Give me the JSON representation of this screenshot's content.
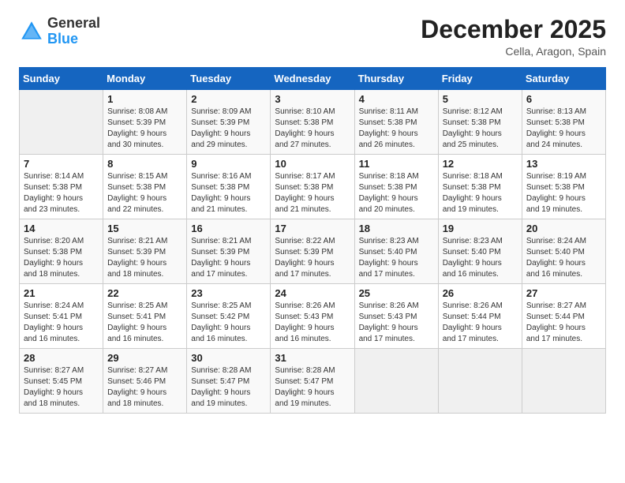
{
  "header": {
    "logo_general": "General",
    "logo_blue": "Blue",
    "month_title": "December 2025",
    "location": "Cella, Aragon, Spain"
  },
  "weekdays": [
    "Sunday",
    "Monday",
    "Tuesday",
    "Wednesday",
    "Thursday",
    "Friday",
    "Saturday"
  ],
  "weeks": [
    [
      {
        "day": "",
        "info": ""
      },
      {
        "day": "1",
        "info": "Sunrise: 8:08 AM\nSunset: 5:39 PM\nDaylight: 9 hours\nand 30 minutes."
      },
      {
        "day": "2",
        "info": "Sunrise: 8:09 AM\nSunset: 5:39 PM\nDaylight: 9 hours\nand 29 minutes."
      },
      {
        "day": "3",
        "info": "Sunrise: 8:10 AM\nSunset: 5:38 PM\nDaylight: 9 hours\nand 27 minutes."
      },
      {
        "day": "4",
        "info": "Sunrise: 8:11 AM\nSunset: 5:38 PM\nDaylight: 9 hours\nand 26 minutes."
      },
      {
        "day": "5",
        "info": "Sunrise: 8:12 AM\nSunset: 5:38 PM\nDaylight: 9 hours\nand 25 minutes."
      },
      {
        "day": "6",
        "info": "Sunrise: 8:13 AM\nSunset: 5:38 PM\nDaylight: 9 hours\nand 24 minutes."
      }
    ],
    [
      {
        "day": "7",
        "info": "Sunrise: 8:14 AM\nSunset: 5:38 PM\nDaylight: 9 hours\nand 23 minutes."
      },
      {
        "day": "8",
        "info": "Sunrise: 8:15 AM\nSunset: 5:38 PM\nDaylight: 9 hours\nand 22 minutes."
      },
      {
        "day": "9",
        "info": "Sunrise: 8:16 AM\nSunset: 5:38 PM\nDaylight: 9 hours\nand 21 minutes."
      },
      {
        "day": "10",
        "info": "Sunrise: 8:17 AM\nSunset: 5:38 PM\nDaylight: 9 hours\nand 21 minutes."
      },
      {
        "day": "11",
        "info": "Sunrise: 8:18 AM\nSunset: 5:38 PM\nDaylight: 9 hours\nand 20 minutes."
      },
      {
        "day": "12",
        "info": "Sunrise: 8:18 AM\nSunset: 5:38 PM\nDaylight: 9 hours\nand 19 minutes."
      },
      {
        "day": "13",
        "info": "Sunrise: 8:19 AM\nSunset: 5:38 PM\nDaylight: 9 hours\nand 19 minutes."
      }
    ],
    [
      {
        "day": "14",
        "info": "Sunrise: 8:20 AM\nSunset: 5:38 PM\nDaylight: 9 hours\nand 18 minutes."
      },
      {
        "day": "15",
        "info": "Sunrise: 8:21 AM\nSunset: 5:39 PM\nDaylight: 9 hours\nand 18 minutes."
      },
      {
        "day": "16",
        "info": "Sunrise: 8:21 AM\nSunset: 5:39 PM\nDaylight: 9 hours\nand 17 minutes."
      },
      {
        "day": "17",
        "info": "Sunrise: 8:22 AM\nSunset: 5:39 PM\nDaylight: 9 hours\nand 17 minutes."
      },
      {
        "day": "18",
        "info": "Sunrise: 8:23 AM\nSunset: 5:40 PM\nDaylight: 9 hours\nand 17 minutes."
      },
      {
        "day": "19",
        "info": "Sunrise: 8:23 AM\nSunset: 5:40 PM\nDaylight: 9 hours\nand 16 minutes."
      },
      {
        "day": "20",
        "info": "Sunrise: 8:24 AM\nSunset: 5:40 PM\nDaylight: 9 hours\nand 16 minutes."
      }
    ],
    [
      {
        "day": "21",
        "info": "Sunrise: 8:24 AM\nSunset: 5:41 PM\nDaylight: 9 hours\nand 16 minutes."
      },
      {
        "day": "22",
        "info": "Sunrise: 8:25 AM\nSunset: 5:41 PM\nDaylight: 9 hours\nand 16 minutes."
      },
      {
        "day": "23",
        "info": "Sunrise: 8:25 AM\nSunset: 5:42 PM\nDaylight: 9 hours\nand 16 minutes."
      },
      {
        "day": "24",
        "info": "Sunrise: 8:26 AM\nSunset: 5:43 PM\nDaylight: 9 hours\nand 16 minutes."
      },
      {
        "day": "25",
        "info": "Sunrise: 8:26 AM\nSunset: 5:43 PM\nDaylight: 9 hours\nand 17 minutes."
      },
      {
        "day": "26",
        "info": "Sunrise: 8:26 AM\nSunset: 5:44 PM\nDaylight: 9 hours\nand 17 minutes."
      },
      {
        "day": "27",
        "info": "Sunrise: 8:27 AM\nSunset: 5:44 PM\nDaylight: 9 hours\nand 17 minutes."
      }
    ],
    [
      {
        "day": "28",
        "info": "Sunrise: 8:27 AM\nSunset: 5:45 PM\nDaylight: 9 hours\nand 18 minutes."
      },
      {
        "day": "29",
        "info": "Sunrise: 8:27 AM\nSunset: 5:46 PM\nDaylight: 9 hours\nand 18 minutes."
      },
      {
        "day": "30",
        "info": "Sunrise: 8:28 AM\nSunset: 5:47 PM\nDaylight: 9 hours\nand 19 minutes."
      },
      {
        "day": "31",
        "info": "Sunrise: 8:28 AM\nSunset: 5:47 PM\nDaylight: 9 hours\nand 19 minutes."
      },
      {
        "day": "",
        "info": ""
      },
      {
        "day": "",
        "info": ""
      },
      {
        "day": "",
        "info": ""
      }
    ]
  ]
}
